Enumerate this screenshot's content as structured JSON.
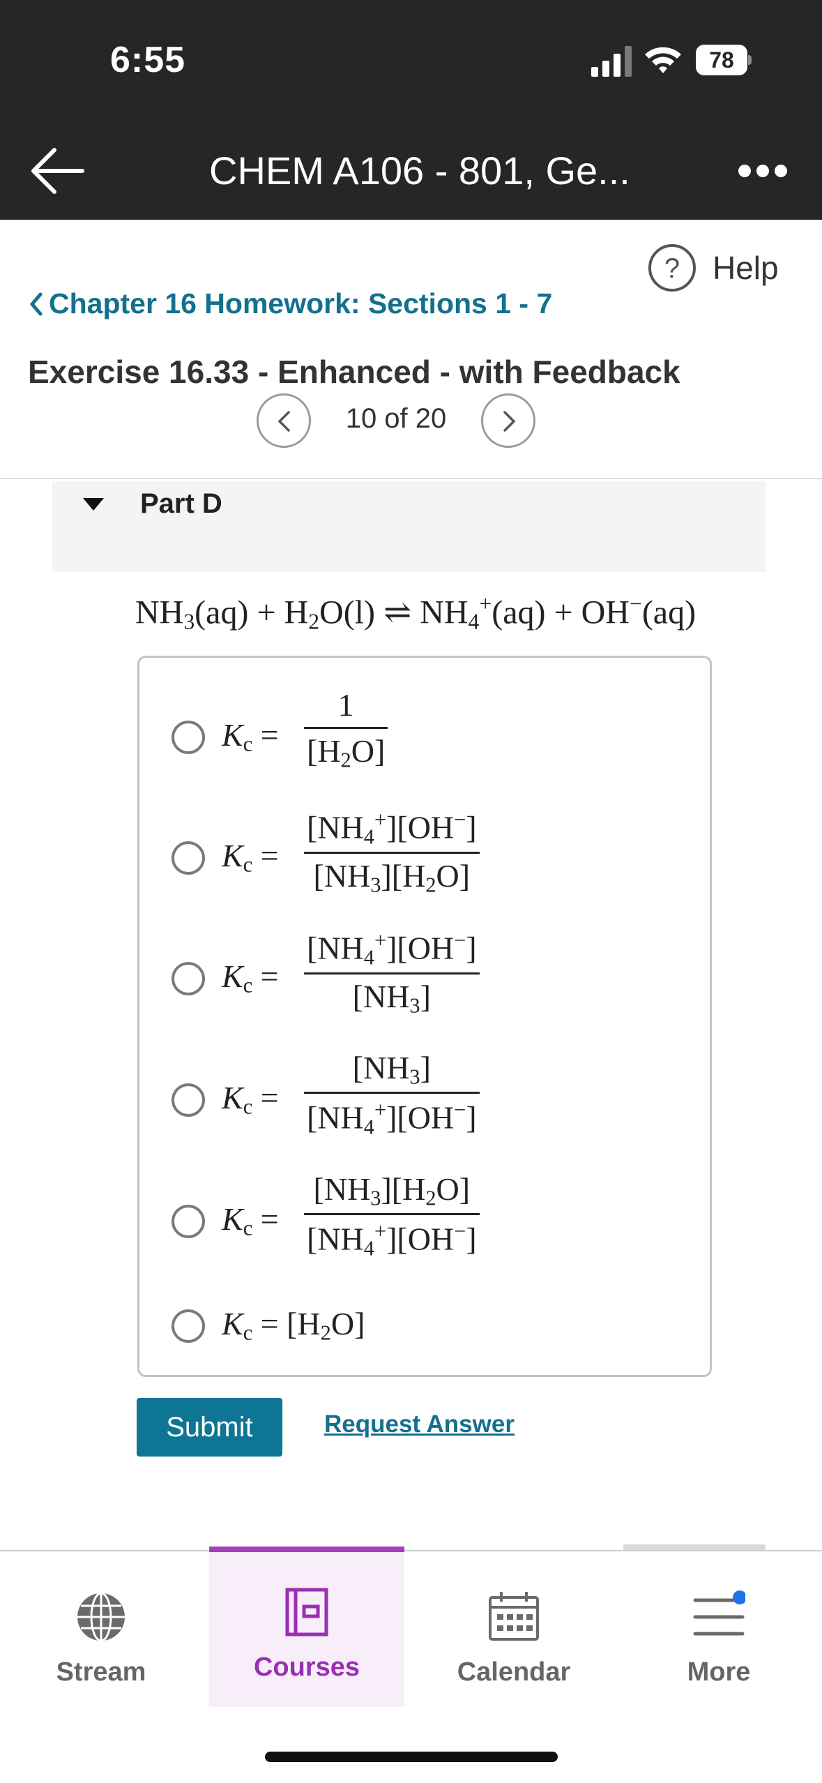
{
  "status_bar": {
    "time": "6:55",
    "battery": "78"
  },
  "header": {
    "title": "CHEM A106 - 801, Ge..."
  },
  "help": {
    "label": "Help"
  },
  "breadcrumb": {
    "label": "Chapter 16 Homework: Sections 1 - 7"
  },
  "exercise": {
    "title": "Exercise 16.33 - Enhanced - with Feedback",
    "pager": "10 of 20"
  },
  "part": {
    "title": "Part D"
  },
  "options": [
    {
      "id": "a",
      "selected": false
    },
    {
      "id": "b",
      "selected": false
    },
    {
      "id": "c",
      "selected": false
    },
    {
      "id": "d",
      "selected": false
    },
    {
      "id": "e",
      "selected": false
    },
    {
      "id": "f",
      "selected": false
    }
  ],
  "actions": {
    "submit": "Submit",
    "request_answer": "Request Answer"
  },
  "tabs": [
    {
      "label": "Stream",
      "icon": "globe-icon"
    },
    {
      "label": "Courses",
      "icon": "courses-icon",
      "active": true
    },
    {
      "label": "Calendar",
      "icon": "calendar-icon"
    },
    {
      "label": "More",
      "icon": "menu-icon",
      "notification": true
    }
  ],
  "colors": {
    "accent": "#13708e",
    "button": "#0f7595",
    "active_tab": "#a33fb8",
    "notification_dot": "#1a73e8"
  }
}
